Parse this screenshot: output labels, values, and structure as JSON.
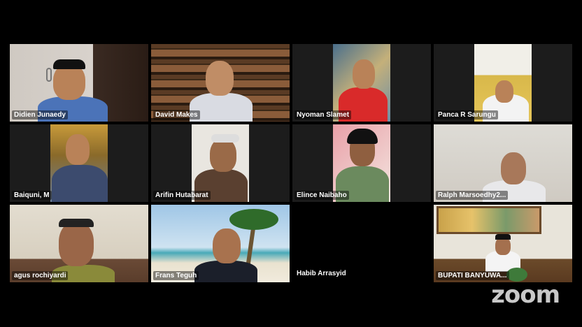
{
  "app": {
    "logo": "zoom"
  },
  "participants": [
    {
      "name": "Didien Junaedy"
    },
    {
      "name": "David Makes"
    },
    {
      "name": "Nyoman Slamet"
    },
    {
      "name": "Panca R Sarungu"
    },
    {
      "name": "Baiquni, M"
    },
    {
      "name": "Arifin Hutabarat"
    },
    {
      "name": "Elince Naibaho"
    },
    {
      "name": "Ralph Marsoedhy2..."
    },
    {
      "name": "agus rochiyardi"
    },
    {
      "name": "Frans Teguh",
      "active_speaker": true,
      "highlight_color": "#3fb950"
    },
    {
      "name": "Habib Arrasyid",
      "video_off": true
    },
    {
      "name": "BUPATI BANYUWA..."
    }
  ]
}
